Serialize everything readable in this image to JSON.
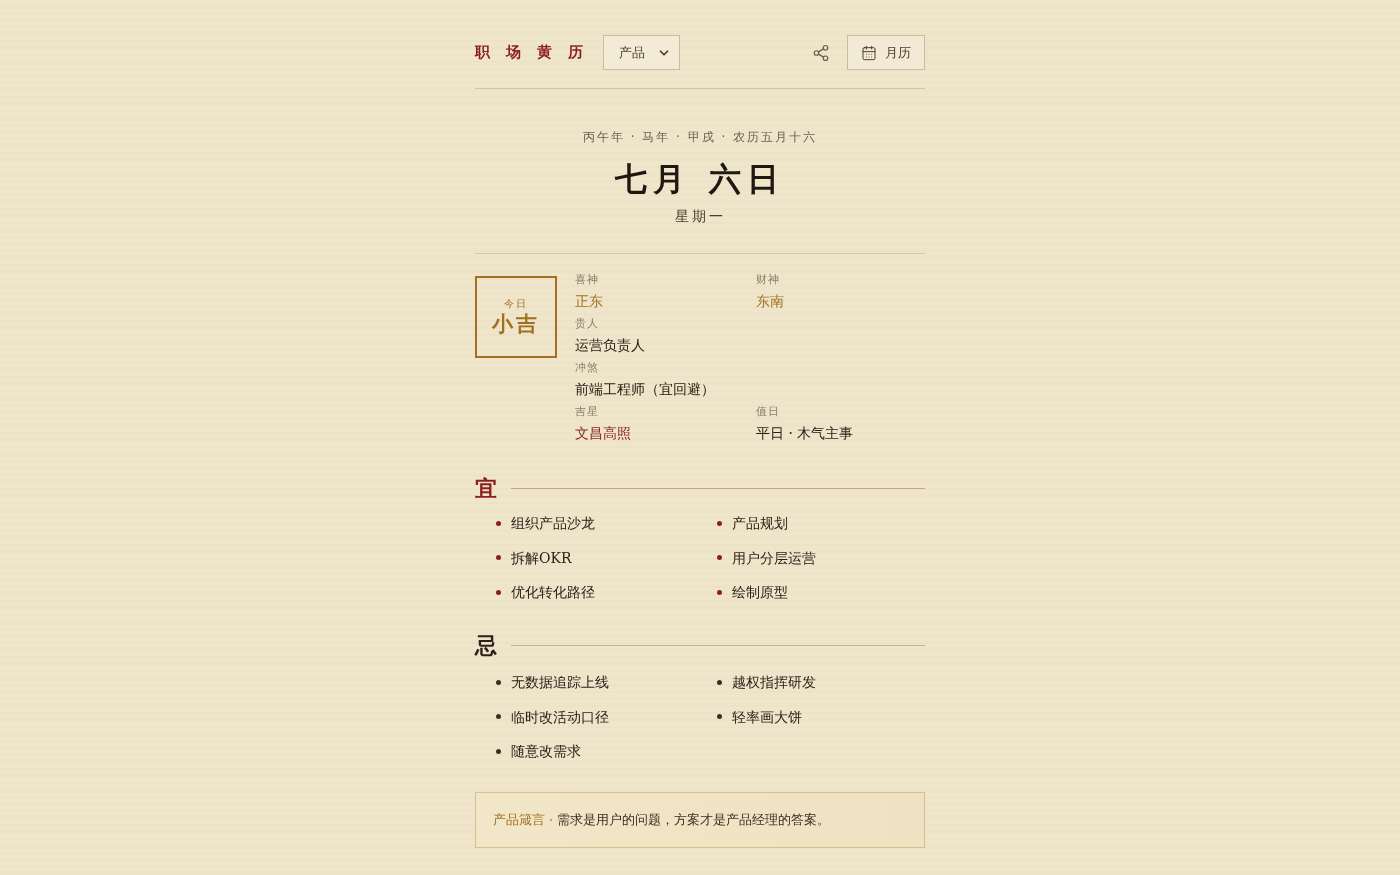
{
  "header": {
    "title": "职场黄历",
    "category_select": {
      "value": "产品"
    },
    "calendar_button": {
      "label": "月历"
    }
  },
  "date": {
    "lunar": "丙午年 · 马年 · 甲戌 · 农历五月十六",
    "solar": "七月 六日",
    "weekday": "星期一"
  },
  "fortune": {
    "badge": {
      "label": "今日",
      "verdict": "小吉"
    },
    "rows": [
      {
        "cells": [
          {
            "label": "喜神",
            "value": "正东",
            "color": "#a0701e"
          },
          {
            "label": "财神",
            "value": "东南",
            "color": "#a0701e"
          }
        ]
      },
      {
        "cells": [
          {
            "label": "贵人",
            "value": "运营负责人",
            "color": "#2b2118"
          }
        ]
      },
      {
        "cells": [
          {
            "label": "冲煞",
            "value": "前端工程师（宜回避）",
            "color": "#2b2118"
          }
        ]
      },
      {
        "cells": [
          {
            "label": "吉星",
            "value": "文昌高照",
            "color": "#8b1e1e"
          },
          {
            "label": "值日",
            "value": "平日 · 木气主事",
            "color": "#2b2118"
          }
        ]
      }
    ]
  },
  "sections": [
    {
      "kind": "good",
      "heading": "宜",
      "items": [
        "组织产品沙龙",
        "产品规划",
        "拆解OKR",
        "用户分层运营",
        "优化转化路径",
        "绘制原型"
      ]
    },
    {
      "kind": "bad",
      "heading": "忌",
      "items": [
        "无数据追踪上线",
        "越权指挥研发",
        "临时改活动口径",
        "轻率画大饼",
        "随意改需求"
      ]
    }
  ],
  "quote": {
    "source": "产品箴言",
    "separator": "·",
    "text": "需求是用户的问题，方案才是产品经理的答案。"
  }
}
